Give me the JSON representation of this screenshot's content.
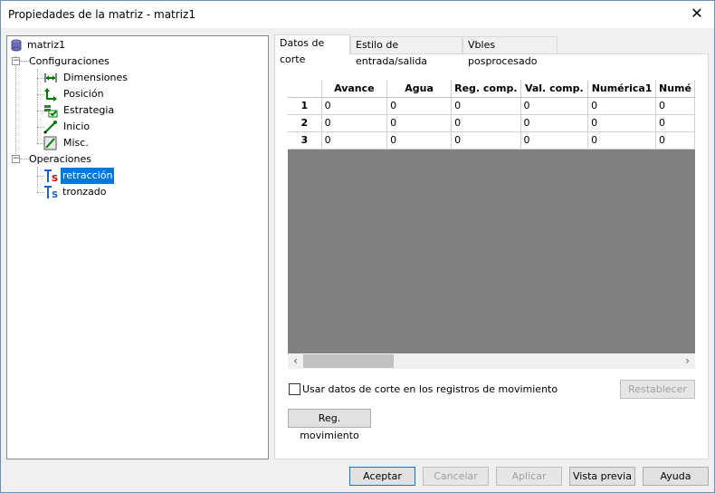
{
  "window": {
    "title": "Propiedades de la matriz - matriz1"
  },
  "tree": {
    "root": {
      "label": "matriz1"
    },
    "configuraciones": {
      "label": "Configuraciones",
      "children": [
        {
          "label": "Dimensiones"
        },
        {
          "label": "Posición"
        },
        {
          "label": "Estrategia"
        },
        {
          "label": "Inicio"
        },
        {
          "label": "Misc."
        }
      ]
    },
    "operaciones": {
      "label": "Operaciones",
      "children": [
        {
          "label": "retracción",
          "selected": true
        },
        {
          "label": "tronzado"
        }
      ]
    }
  },
  "tabs": [
    {
      "label": "Datos de corte",
      "active": true
    },
    {
      "label": "Estilo de entrada/salida"
    },
    {
      "label": "Vbles posprocesado"
    }
  ],
  "grid": {
    "columns": [
      "Avance",
      "Agua",
      "Reg. comp.",
      "Val. comp.",
      "Numérica1",
      "Numé"
    ],
    "rows": [
      {
        "num": "1",
        "cells": [
          "0",
          "0",
          "0",
          "0",
          "0",
          "0"
        ]
      },
      {
        "num": "2",
        "cells": [
          "0",
          "0",
          "0",
          "0",
          "0",
          "0"
        ]
      },
      {
        "num": "3",
        "cells": [
          "0",
          "0",
          "0",
          "0",
          "0",
          "0"
        ]
      }
    ]
  },
  "options": {
    "use_cut_data_label": "Usar datos de corte en los registros de movimiento",
    "reset_label": "Restablecer",
    "move_registers_label": "Reg. movimiento"
  },
  "footer": {
    "accept": "Aceptar",
    "cancel": "Cancelar",
    "apply": "Aplicar",
    "preview": "Vista previa",
    "help": "Ayuda"
  },
  "colors": {
    "selection": "#0078d7",
    "grid_empty": "#808080"
  }
}
